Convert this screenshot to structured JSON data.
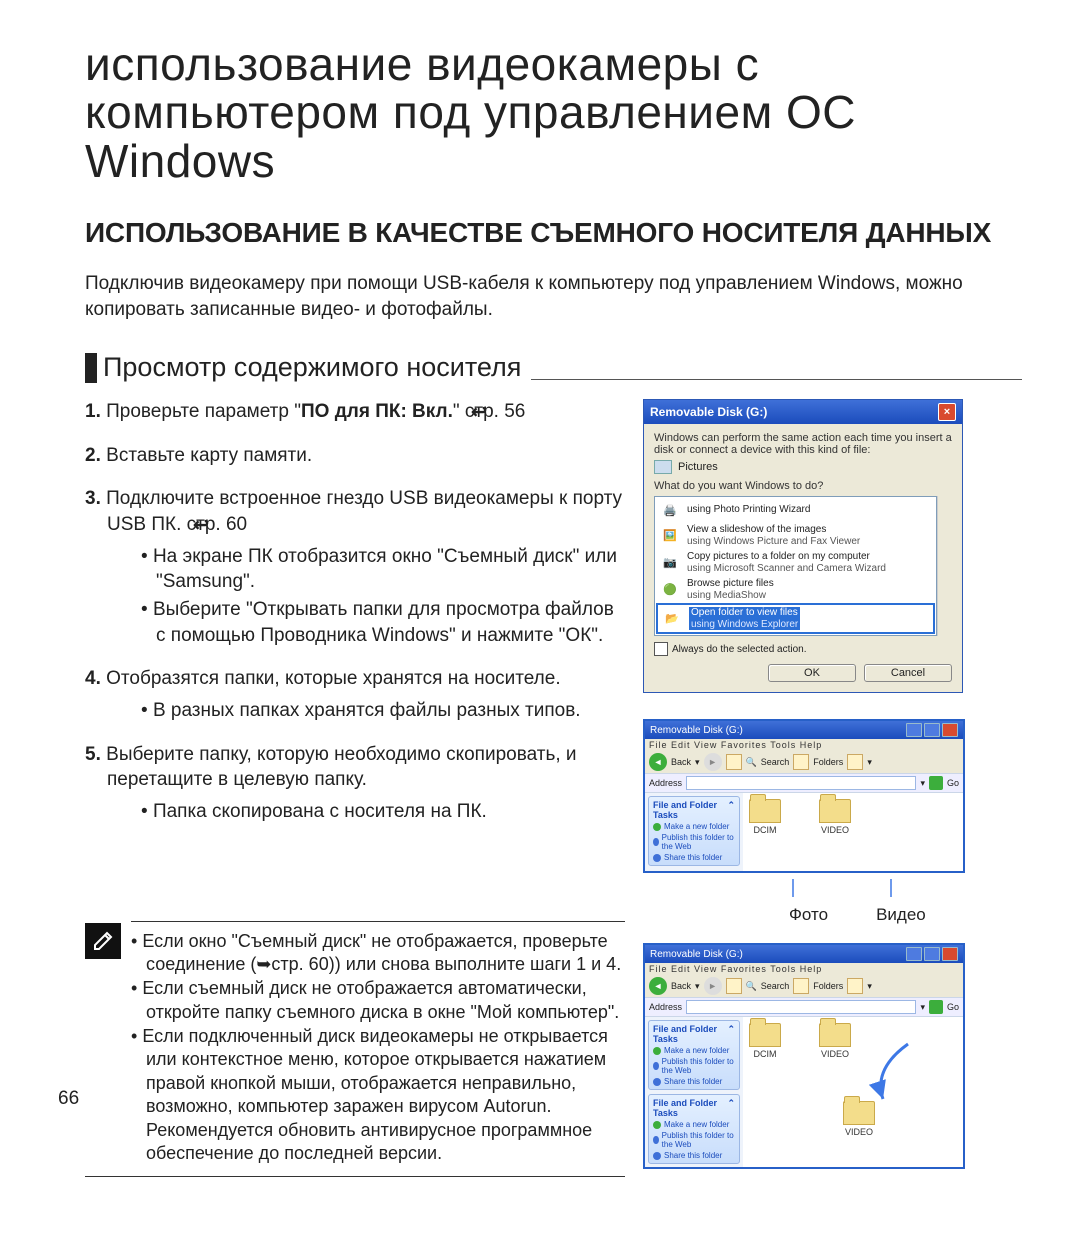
{
  "chapter_title_line1": "использование видеокамеры с",
  "chapter_title_line2": "компьютером под управлением ОС Windows",
  "h1": "ИСПОЛЬЗОВАНИЕ В КАЧЕСТВЕ СЪЕМНОГО НОСИТЕЛЯ ДАННЫХ",
  "intro": "Подключив видеокамеру при помощи USB-кабеля к компьютеру под управлением Windows, можно копировать записанные видео- и фотофайлы.",
  "section_title": "Просмотр содержимого носителя",
  "steps": {
    "s1_pre": "Проверьте параметр \"",
    "s1_bold": "ПО для ПК: Вкл.",
    "s1_post": "\" ",
    "s1_page": "стр. 56",
    "s2": "Вставьте карту памяти.",
    "s3_main": "Подключите встроенное гнездо USB видеокамеры к порту USB ПК. ",
    "s3_page": "стр. 60",
    "s3_b1": "На экране ПК отобразится окно \"Съемный диск\" или \"Samsung\".",
    "s3_b2": "Выберите \"Открывать папки для просмотра файлов с помощью Проводника Windows\" и нажмите \"ОК\".",
    "s4_main": "Отобразятся папки, которые хранятся на носителе.",
    "s4_b1": "В разных папках хранятся файлы разных типов.",
    "s5_main": "Выберите папку, которую необходимо скопировать, и перетащите в целевую папку.",
    "s5_b1": "Папка скопирована с носителя на ПК."
  },
  "notes": {
    "n1": "Если окно \"Съемный диск\" не отображается, проверьте соединение (➥стр. 60)) или снова выполните шаги 1 и 4.",
    "n2": "Если съемный диск не отображается автоматически, откройте папку съемного диска в окне \"Мой компьютер\".",
    "n3": "Если подключенный диск видеокамеры не открывается или контекстное меню, которое открывается нажатием правой кнопкой мыши, отображается неправильно, возможно, компьютер заражен вирусом Autorun. Рекомендуется обновить антивирусное программное обеспечение до последней версии."
  },
  "page_number": "66",
  "callout_photo": "Фото",
  "callout_video": "Видео",
  "dialog": {
    "title": "Removable Disk (G:)",
    "line1": "Windows can perform the same action each time you insert a disk or connect a device with this kind of file:",
    "pictures": "Pictures",
    "line2": "What do you want Windows to do?",
    "opt1_t": "using Photo Printing Wizard",
    "opt2_t": "View a slideshow of the images",
    "opt2_s": "using Windows Picture and Fax Viewer",
    "opt3_t": "Copy pictures to a folder on my computer",
    "opt3_s": "using Microsoft Scanner and Camera Wizard",
    "opt4_t": "Browse picture files",
    "opt4_s": "using MediaShow",
    "opt5_t": "Open folder to view files",
    "opt5_s": "using Windows Explorer",
    "always": "Always do the selected action.",
    "ok": "OK",
    "cancel": "Cancel"
  },
  "explorer": {
    "title": "Removable Disk (G:)",
    "menu": "File  Edit  View  Favorites  Tools  Help",
    "back": "Back",
    "search": "Search",
    "folders": "Folders",
    "address": "Address",
    "go": "Go",
    "panel_title": "File and Folder Tasks",
    "task1": "Make a new folder",
    "task2": "Publish this folder to the Web",
    "task3": "Share this folder",
    "folder1": "DCIM",
    "folder2": "VIDEO"
  }
}
